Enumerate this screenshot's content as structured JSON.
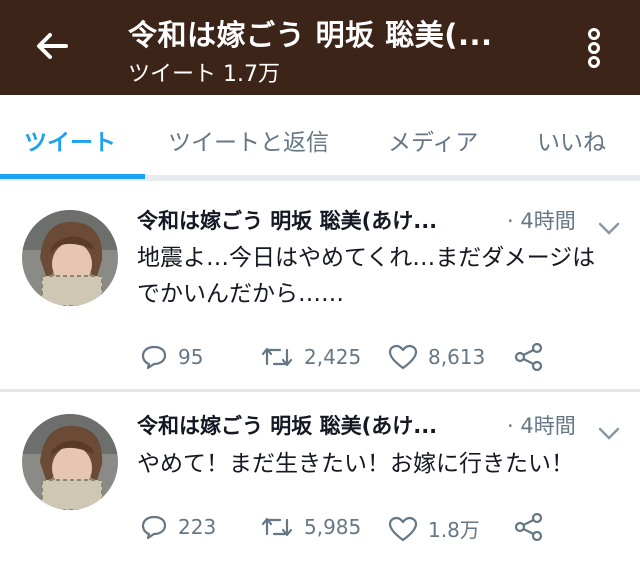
{
  "header": {
    "title": "令和は嫁ごう 明坂 聡美(...",
    "subtitle": "ツイート 1.7万",
    "bg_color": "#3d2418"
  },
  "tabs": [
    {
      "label": "ツイート",
      "active": true
    },
    {
      "label": "ツイートと返信",
      "active": false
    },
    {
      "label": "メディア",
      "active": false
    },
    {
      "label": "いいね",
      "active": false
    }
  ],
  "accent_color": "#1da1f2",
  "tweets": [
    {
      "name": "令和は嫁ごう 明坂 聡美(あけ...",
      "time": "· 4時間",
      "text": "地震よ…今日はやめてくれ…まだダメージはでかいんだから……",
      "replies": "95",
      "retweets": "2,425",
      "likes": "8,613"
    },
    {
      "name": "令和は嫁ごう 明坂 聡美(あけ...",
      "time": "· 4時間",
      "text": "やめて！まだ生きたい！お嫁に行きたい！",
      "replies": "223",
      "retweets": "5,985",
      "likes": "1.8万"
    }
  ],
  "icons": {
    "back": "arrow-left-icon",
    "more": "vertical-dots-icon",
    "chevron": "chevron-down-icon",
    "reply": "reply-bubble-icon",
    "retweet": "retweet-icon",
    "like": "heart-icon",
    "share": "share-icon"
  }
}
